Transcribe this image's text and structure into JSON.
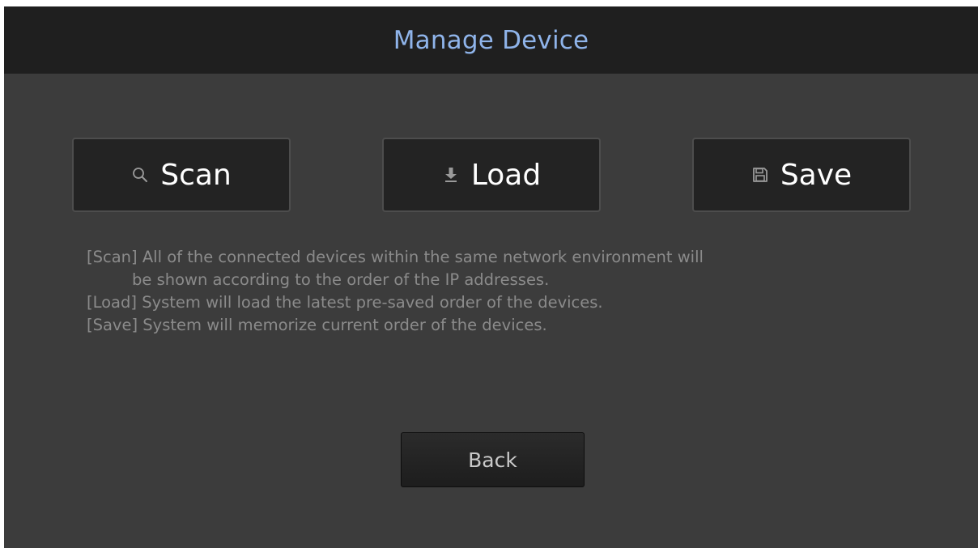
{
  "header": {
    "title": "Manage Device",
    "title_color": "#8fb4ea"
  },
  "actions": [
    {
      "label": "Scan",
      "icon": "search-icon"
    },
    {
      "label": "Load",
      "icon": "download-icon"
    },
    {
      "label": "Save",
      "icon": "floppy-disk-icon"
    }
  ],
  "description": {
    "lines": [
      "[Scan] All of the connected devices within the same network environment will",
      "be shown according to the order of the IP addresses.",
      "[Load] System will load the latest pre-saved order of the devices.",
      "[Save] System will memorize current order of the devices."
    ]
  },
  "footer": {
    "back_label": "Back"
  }
}
